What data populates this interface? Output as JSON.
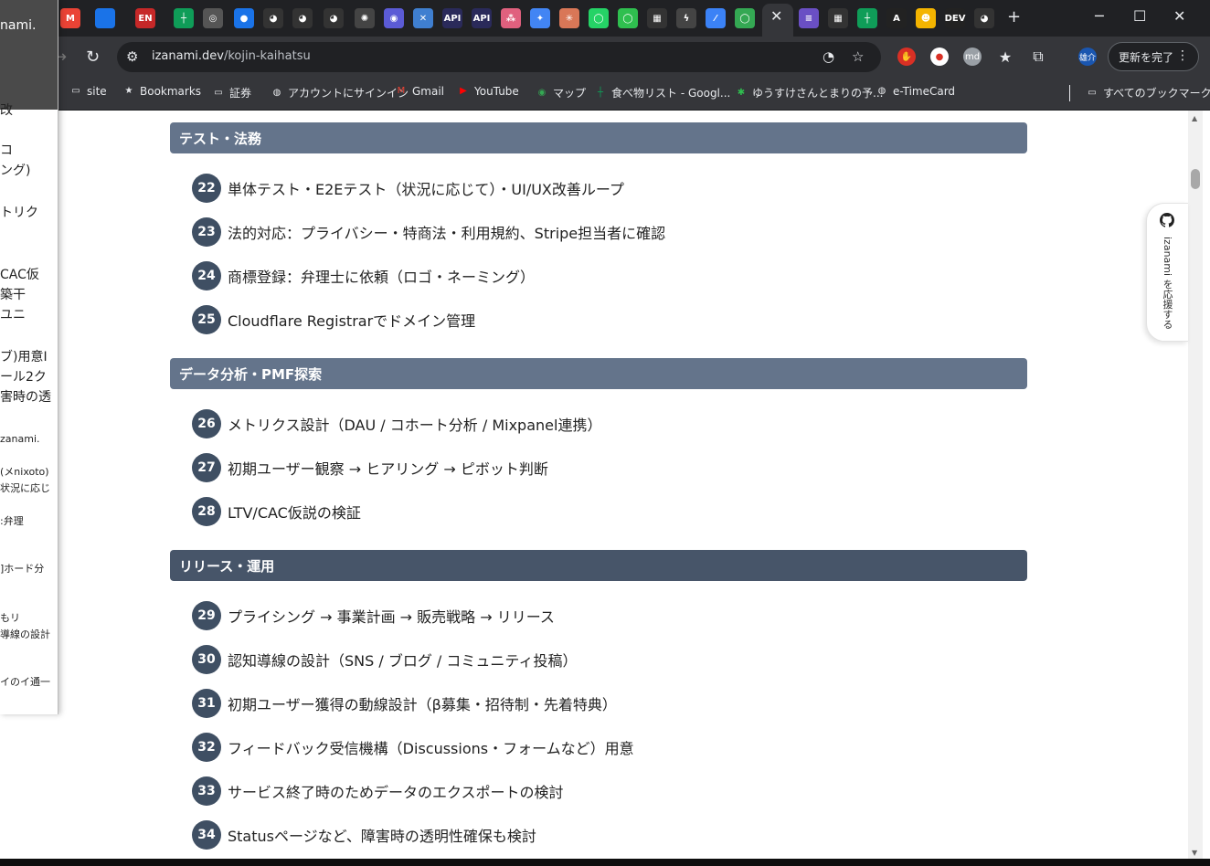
{
  "browser": {
    "url_host": "izanami.dev",
    "url_path": "/kojin-kaihatsu",
    "tab_close": "✕",
    "new_tab": "+",
    "update_button": "更新を完了",
    "profile_badge": "雄介",
    "tab_icons": [
      {
        "label": "M",
        "color": "#ea4335"
      },
      {
        "label": "",
        "color": "#1a73e8"
      },
      {
        "label": "EN",
        "color": "#c62828"
      },
      {
        "label": "┼",
        "color": "#0f9d58"
      },
      {
        "label": "◎",
        "color": "#555"
      },
      {
        "label": "●",
        "color": "#1a73e8"
      },
      {
        "label": "◕",
        "color": "#333"
      },
      {
        "label": "◕",
        "color": "#333"
      },
      {
        "label": "◕",
        "color": "#333"
      },
      {
        "label": "✺",
        "color": "#444"
      },
      {
        "label": "◉",
        "color": "#5b5bd6"
      },
      {
        "label": "✕",
        "color": "#3f7fd0"
      },
      {
        "label": "API",
        "color": "#2a2a5a"
      },
      {
        "label": "API",
        "color": "#2a2a5a"
      },
      {
        "label": "⁂",
        "color": "#e0607e"
      },
      {
        "label": "✦",
        "color": "#4285f4"
      },
      {
        "label": "✳",
        "color": "#d97757"
      },
      {
        "label": "◯",
        "color": "#25d366"
      },
      {
        "label": "◯",
        "color": "#2fbf4f"
      },
      {
        "label": "▦",
        "color": "#333"
      },
      {
        "label": "ϟ",
        "color": "#444"
      },
      {
        "label": "⁄",
        "color": "#3b82f6"
      },
      {
        "label": "◯",
        "color": "#34a853"
      }
    ],
    "tab_icons_right": [
      {
        "label": "≡",
        "color": "#6a4fc4"
      },
      {
        "label": "▦",
        "color": "#333"
      },
      {
        "label": "┼",
        "color": "#0f9d58"
      },
      {
        "label": "A",
        "color": "#222"
      },
      {
        "label": "☻",
        "color": "#f4b400"
      },
      {
        "label": "DEV",
        "color": "#222"
      },
      {
        "label": "◕",
        "color": "#333"
      }
    ]
  },
  "bookmarks": [
    {
      "label": "site",
      "icon": "folder-icon"
    },
    {
      "label": "Bookmarks",
      "icon": "star-icon"
    },
    {
      "label": "証券",
      "icon": "folder-icon"
    },
    {
      "label": "アカウントにサインイン",
      "icon": "globe-icon"
    },
    {
      "label": "Gmail",
      "icon": "gmail-icon"
    },
    {
      "label": "YouTube",
      "icon": "youtube-icon"
    },
    {
      "label": "マップ",
      "icon": "maps-icon"
    },
    {
      "label": "食べ物リスト - Googl...",
      "icon": "sheets-icon"
    },
    {
      "label": "ゆうすけさんとまりの予...",
      "icon": "app-icon"
    },
    {
      "label": "e-TimeCard",
      "icon": "globe-icon"
    },
    {
      "label": "すべてのブックマーク",
      "icon": "folder-icon"
    }
  ],
  "sections": [
    {
      "title": "テスト・法務",
      "color": "#64748b",
      "tasks": [
        {
          "num": "22",
          "text": "単体テスト・E2Eテスト（状況に応じて）・UI/UX改善ループ"
        },
        {
          "num": "23",
          "text": "法的対応：プライバシー・特商法・利用規約、Stripe担当者に確認"
        },
        {
          "num": "24",
          "text": "商標登録：弁理士に依頼（ロゴ・ネーミング）"
        },
        {
          "num": "25",
          "text": "Cloudflare Registrarでドメイン管理"
        }
      ]
    },
    {
      "title": "データ分析・PMF探索",
      "color": "#64748b",
      "tasks": [
        {
          "num": "26",
          "text": "メトリクス設計（DAU / コホート分析 / Mixpanel連携）"
        },
        {
          "num": "27",
          "text": "初期ユーザー観察 → ヒアリング → ピボット判断"
        },
        {
          "num": "28",
          "text": "LTV/CAC仮説の検証"
        }
      ]
    },
    {
      "title": "リリース・運用",
      "color": "#475569",
      "tasks": [
        {
          "num": "29",
          "text": "プライシング → 事業計画 → 販売戦略 → リリース"
        },
        {
          "num": "30",
          "text": "認知導線の設計（SNS / ブログ / コミュニティ投稿）"
        },
        {
          "num": "31",
          "text": "初期ユーザー獲得の動線設計（β募集・招待制・先着特典）"
        },
        {
          "num": "32",
          "text": "フィードバック受信機構（Discussions・フォームなど）用意"
        },
        {
          "num": "33",
          "text": "サービス終了時のためデータのエクスポートの検討"
        },
        {
          "num": "34",
          "text": "Statusページなど、障害時の透明性確保も検討"
        }
      ]
    }
  ],
  "github_tab": {
    "label": "izanami を応援する"
  },
  "overlay": {
    "lines": [
      "nami.",
      "改",
      "コ",
      "ング)",
      "トリク",
      "CAC仮",
      "築干",
      "ユニ",
      "ブ)用意I",
      "ール2ク",
      "害時の透",
      "zanami.",
      "(メnixoto)",
      "状況に応じ",
      ":弁理",
      "]ホード分",
      "もリ",
      "導線の設計",
      "イのイ通一"
    ]
  }
}
